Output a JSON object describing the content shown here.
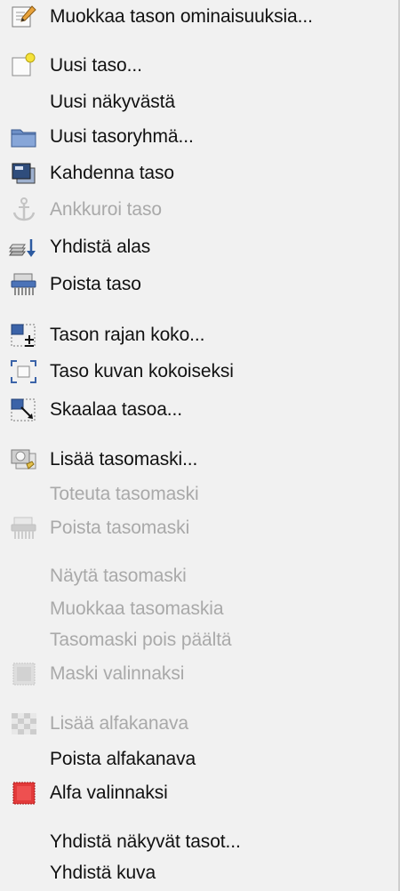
{
  "colors": {
    "background": "#f1f1f1",
    "text": "#111111",
    "disabled_text": "#a9a9a9",
    "accent_blue": "#3b63a8",
    "alpha_red": "#e23a3a"
  },
  "menu": {
    "items": [
      {
        "label": "Muokkaa tason ominaisuuksia...",
        "icon": "edit-pencil-icon",
        "enabled": true
      },
      {
        "label": "Uusi taso...",
        "icon": "new-layer-icon",
        "enabled": true
      },
      {
        "label": "Uusi näkyvästä",
        "icon": "",
        "enabled": true
      },
      {
        "label": "Uusi tasoryhmä...",
        "icon": "folder-icon",
        "enabled": true
      },
      {
        "label": "Kahdenna taso",
        "icon": "duplicate-icon",
        "enabled": true
      },
      {
        "label": "Ankkuroi taso",
        "icon": "anchor-icon",
        "enabled": false
      },
      {
        "label": "Yhdistä alas",
        "icon": "merge-down-icon",
        "enabled": true
      },
      {
        "label": "Poista taso",
        "icon": "shredder-icon",
        "enabled": true
      },
      {
        "label": "Tason rajan koko...",
        "icon": "layer-boundary-icon",
        "enabled": true
      },
      {
        "label": "Taso kuvan kokoiseksi",
        "icon": "layer-to-image-size-icon",
        "enabled": true
      },
      {
        "label": "Skaalaa tasoa...",
        "icon": "scale-layer-icon",
        "enabled": true
      },
      {
        "label": "Lisää tasomaski...",
        "icon": "add-mask-icon",
        "enabled": true
      },
      {
        "label": "Toteuta tasomaski",
        "icon": "",
        "enabled": false
      },
      {
        "label": "Poista tasomaski",
        "icon": "shredder-icon",
        "enabled": false
      },
      {
        "label": "Näytä tasomaski",
        "icon": "",
        "enabled": false
      },
      {
        "label": "Muokkaa tasomaskia",
        "icon": "",
        "enabled": false
      },
      {
        "label": "Tasomaski pois päältä",
        "icon": "",
        "enabled": false
      },
      {
        "label": "Maski valinnaksi",
        "icon": "mask-selection-icon",
        "enabled": false
      },
      {
        "label": "Lisää alfakanava",
        "icon": "checkerboard-icon",
        "enabled": false
      },
      {
        "label": "Poista alfakanava",
        "icon": "",
        "enabled": true
      },
      {
        "label": "Alfa valinnaksi",
        "icon": "alpha-selection-icon",
        "enabled": true
      },
      {
        "label": "Yhdistä näkyvät tasot...",
        "icon": "",
        "enabled": true
      },
      {
        "label": "Yhdistä kuva",
        "icon": "",
        "enabled": true
      }
    ]
  }
}
